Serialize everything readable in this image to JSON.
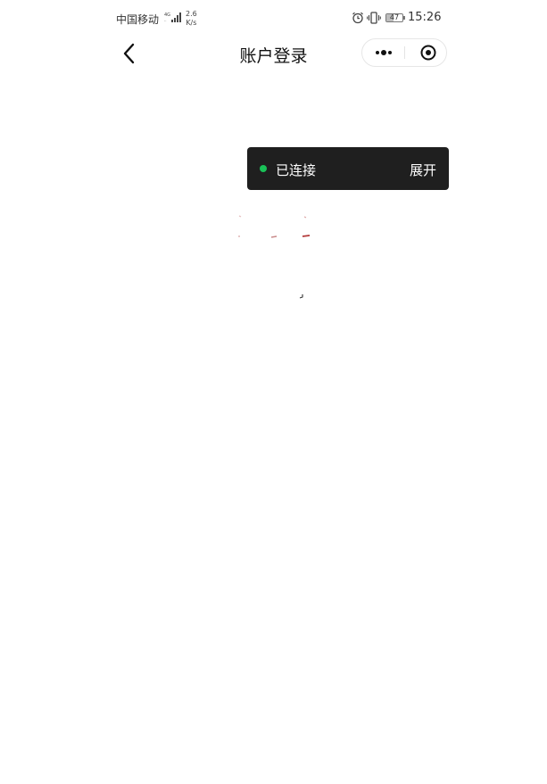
{
  "status_bar": {
    "carrier": "中国移动",
    "network_type": "4G",
    "speed_value": "2.6",
    "speed_unit": "K/s",
    "battery": "47",
    "battery_fraction": 0.47,
    "time": "15:26",
    "icons": [
      "signal-icon",
      "alarm-icon",
      "vibrate-icon",
      "battery-icon"
    ]
  },
  "nav": {
    "title": "账户登录",
    "back_icon": "chevron-left-icon",
    "more_icon": "more-dots-icon",
    "close_icon": "target-close-icon"
  },
  "toast": {
    "status": "已连接",
    "expand_label": "展开",
    "dot_color": "#19c157",
    "background": "#1f1f1f"
  }
}
